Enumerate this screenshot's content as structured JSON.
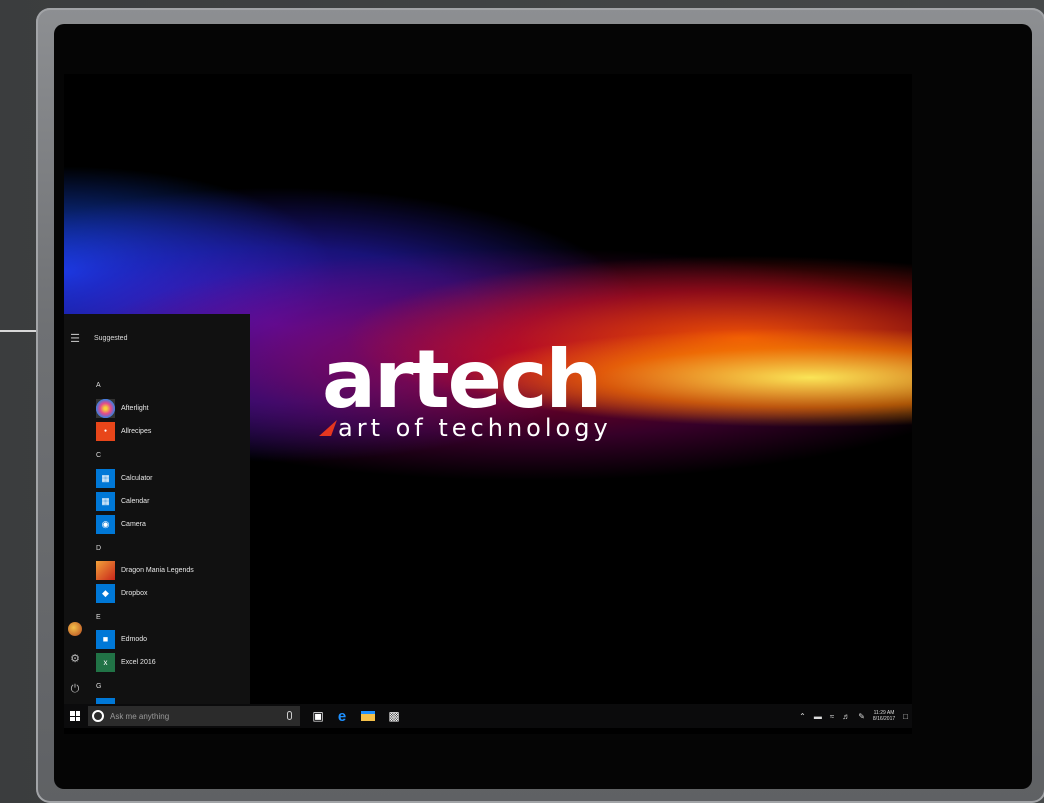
{
  "colors": {
    "accent": "#0078d7",
    "brand_red": "#e5371f",
    "taskbar": "#0b0b0c",
    "start_menu": "#111111"
  },
  "logo": {
    "word": "artech",
    "tagline": "art of technology"
  },
  "start_menu": {
    "heading": "Suggested",
    "rail_icons": [
      "hamburger-icon",
      "user-avatar",
      "settings-icon",
      "power-icon"
    ],
    "sections": [
      {
        "letter": "A",
        "apps": [
          {
            "name": "Afterlight",
            "icon": "afterlight-icon",
            "color": "#333"
          },
          {
            "name": "Allrecipes",
            "icon": "allrecipes-icon",
            "color": "#e8461a"
          }
        ]
      },
      {
        "letter": "C",
        "apps": [
          {
            "name": "Calculator",
            "icon": "calculator-icon",
            "color": "#0078d7"
          },
          {
            "name": "Calendar",
            "icon": "calendar-icon",
            "color": "#0078d7"
          },
          {
            "name": "Camera",
            "icon": "camera-icon",
            "color": "#0078d7"
          }
        ]
      },
      {
        "letter": "D",
        "apps": [
          {
            "name": "Dragon Mania Legends",
            "icon": "dragon-icon",
            "color": "#c8461a"
          },
          {
            "name": "Dropbox",
            "icon": "dropbox-icon",
            "color": "#0078d7"
          }
        ]
      },
      {
        "letter": "E",
        "apps": [
          {
            "name": "Edmodo",
            "icon": "edmodo-icon",
            "color": "#0078d7"
          },
          {
            "name": "Excel 2016",
            "icon": "excel-icon",
            "color": "#217346"
          }
        ]
      },
      {
        "letter": "G",
        "apps": []
      }
    ]
  },
  "taskbar": {
    "search_placeholder": "Ask me anything",
    "pinned": [
      "task-view-icon",
      "edge-icon",
      "file-explorer-icon",
      "store-icon"
    ],
    "time": "11:29 AM",
    "date": "8/16/2017"
  }
}
